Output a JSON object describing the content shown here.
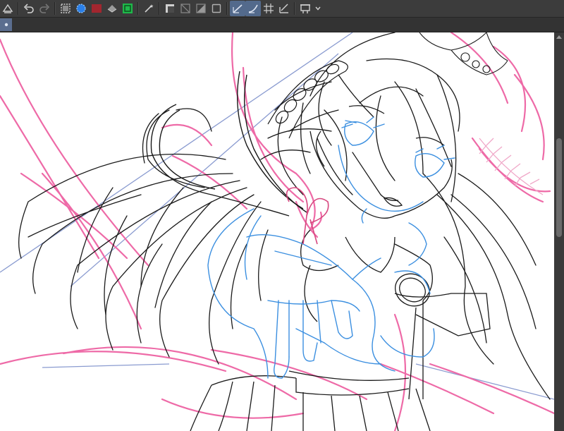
{
  "app": {
    "accent_color": "#536a8c"
  },
  "toolbar": {
    "groups": [
      [
        "hand-tool-icon",
        "undo-icon",
        "redo-icon"
      ],
      [
        "select-all-icon",
        "invert-selection-icon",
        "fill-color-icon",
        "fill-transparent-icon",
        "layer-color-icon"
      ],
      [
        "auto-action-icon"
      ],
      [
        "mask-icon",
        "ruler-toggle-icon",
        "gradient-icon",
        "frame-icon"
      ],
      [
        "snap-ruler-icon",
        "snap-special-ruler-icon",
        "grid-icon",
        "perspective-icon"
      ],
      [
        "canvas-settings-icon"
      ]
    ],
    "active_tools": [
      "snap-ruler-icon",
      "snap-special-ruler-icon"
    ]
  },
  "tab_bar": {
    "pin_icon": "dot-icon"
  },
  "canvas": {
    "background": "#ffffff",
    "line_colors": {
      "lineart": "#1a1a1a",
      "body_sketch": "#3b8fe0",
      "pink_sketch": "#ee6aa7",
      "guide_lines": "#8a9bd0"
    }
  }
}
